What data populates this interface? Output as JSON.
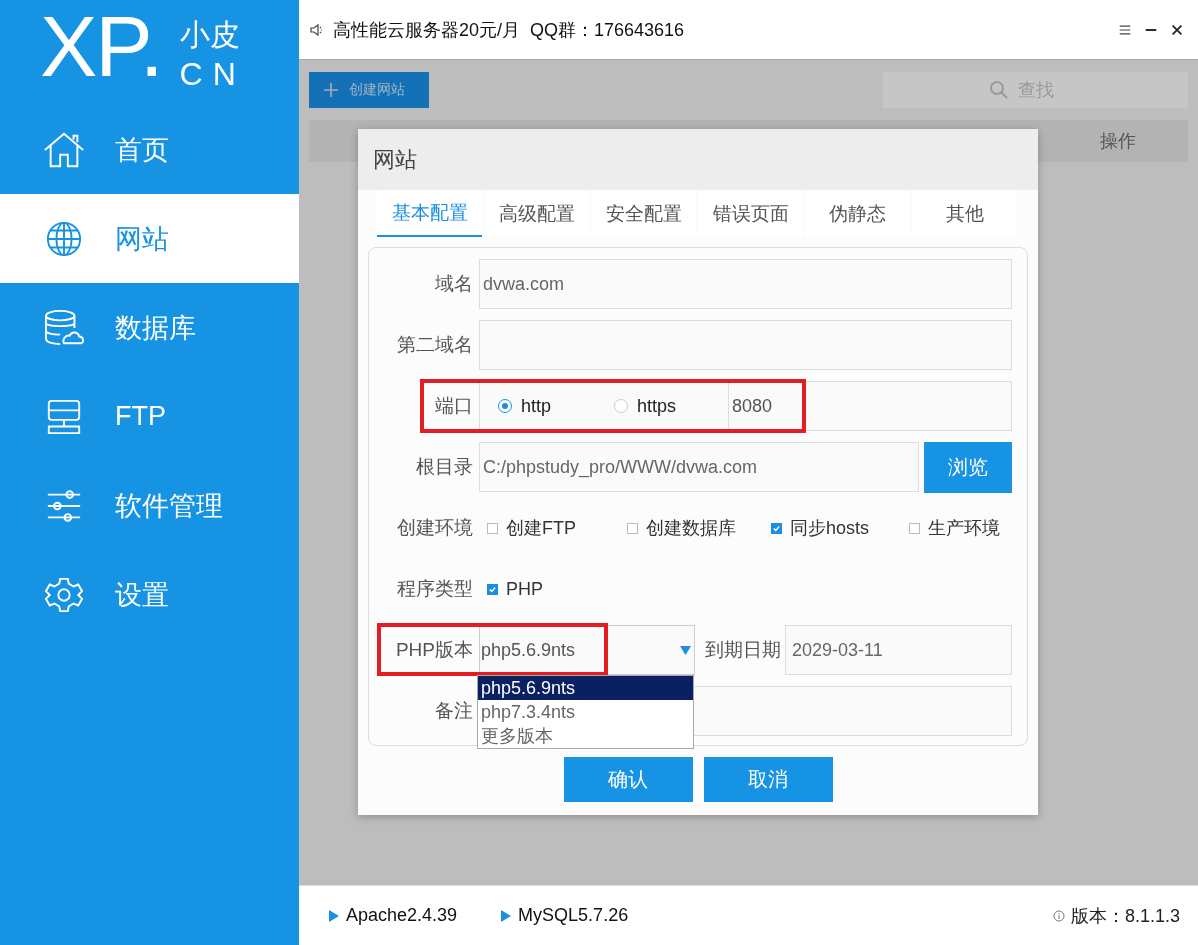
{
  "logo": {
    "main": "XP.",
    "sub_top": "小皮",
    "sub_bottom": "CN"
  },
  "sidebar": {
    "items": [
      {
        "label": "首页",
        "selected": false
      },
      {
        "label": "网站",
        "selected": true
      },
      {
        "label": "数据库",
        "selected": false
      },
      {
        "label": "FTP",
        "selected": false
      },
      {
        "label": "软件管理",
        "selected": false
      },
      {
        "label": "设置",
        "selected": false
      }
    ]
  },
  "top_bar": {
    "title": "高性能云服务器20元/月  QQ群：176643616"
  },
  "toolbar": {
    "create_button": "创建网站",
    "search_placeholder": "查找"
  },
  "table": {
    "columns": [
      "操作"
    ]
  },
  "dialog": {
    "title": "网站",
    "tabs": [
      {
        "label": "基本配置",
        "selected": true
      },
      {
        "label": "高级配置",
        "selected": false
      },
      {
        "label": "安全配置",
        "selected": false
      },
      {
        "label": "错误页面",
        "selected": false
      },
      {
        "label": "伪静态",
        "selected": false
      },
      {
        "label": "其他",
        "selected": false
      }
    ],
    "domain": {
      "label": "域名",
      "value": "dvwa.com"
    },
    "second_domain": {
      "label": "第二域名"
    },
    "port": {
      "label": "端口",
      "protocols": [
        {
          "label": "http",
          "selected": true
        },
        {
          "label": "https",
          "selected": false
        }
      ],
      "value": "8080"
    },
    "root": {
      "label": "根目录",
      "value": "C:/phpstudy_pro/WWW/dvwa.com",
      "button": "浏览"
    },
    "environment": {
      "label": "创建环境",
      "options": [
        {
          "label": "创建FTP",
          "checked": false
        },
        {
          "label": "创建数据库",
          "checked": false
        },
        {
          "label": "同步hosts",
          "checked": true
        },
        {
          "label": "生产环境",
          "checked": false
        }
      ]
    },
    "program_type": {
      "label": "程序类型",
      "options": [
        {
          "label": "PHP",
          "checked": true
        }
      ]
    },
    "php_version": {
      "label": "PHP版本",
      "value": "php5.6.9nts",
      "options": [
        {
          "label": "php5.6.9nts",
          "selected": true
        },
        {
          "label": "php7.3.4nts",
          "selected": false
        },
        {
          "label": "更多版本",
          "selected": false
        }
      ]
    },
    "expiry": {
      "label": "到期日期",
      "value": "2029-03-11"
    },
    "note": {
      "label": "备注"
    },
    "buttons": [
      "确认",
      "取消"
    ]
  },
  "status_bar": {
    "services": [
      "Apache2.4.39",
      "MySQL5.7.26"
    ],
    "version": "版本：8.1.1.3"
  }
}
